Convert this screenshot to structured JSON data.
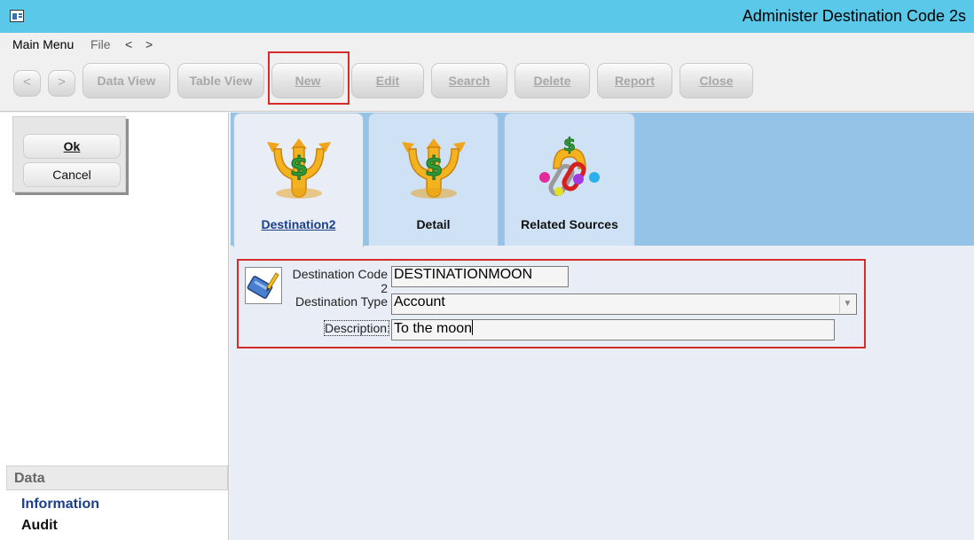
{
  "window": {
    "title": "Administer Destination Code 2s"
  },
  "menu": {
    "main": "Main Menu",
    "file": "File",
    "back": "<",
    "forward": ">"
  },
  "toolbar": {
    "prev": "<",
    "next": ">",
    "data_view": "Data View",
    "table_view": "Table View",
    "new": "New",
    "edit": "Edit",
    "search": "Search",
    "delete": "Delete",
    "report": "Report",
    "close": "Close"
  },
  "actions": {
    "ok": "Ok",
    "cancel": "Cancel"
  },
  "sidebar": {
    "section": "Data",
    "links": [
      "Information",
      "Audit"
    ]
  },
  "tabs": [
    {
      "label": "Destination2",
      "icon": "money-arrows-icon",
      "active": true
    },
    {
      "label": "Detail",
      "icon": "money-arrows-icon",
      "active": false
    },
    {
      "label": "Related Sources",
      "icon": "money-chain-links-icon",
      "active": false
    }
  ],
  "form": {
    "code_label": "Destination Code 2",
    "code_value": "DESTINATIONMOON",
    "type_label": "Destination Type",
    "type_value": "Account",
    "desc_label": "Description:",
    "desc_value": "To the moon"
  },
  "colors": {
    "titlebar": "#5ac8e8",
    "tabstrip": "#95c3e8",
    "highlight": "#d62b2b",
    "link": "#1c3f8a"
  }
}
